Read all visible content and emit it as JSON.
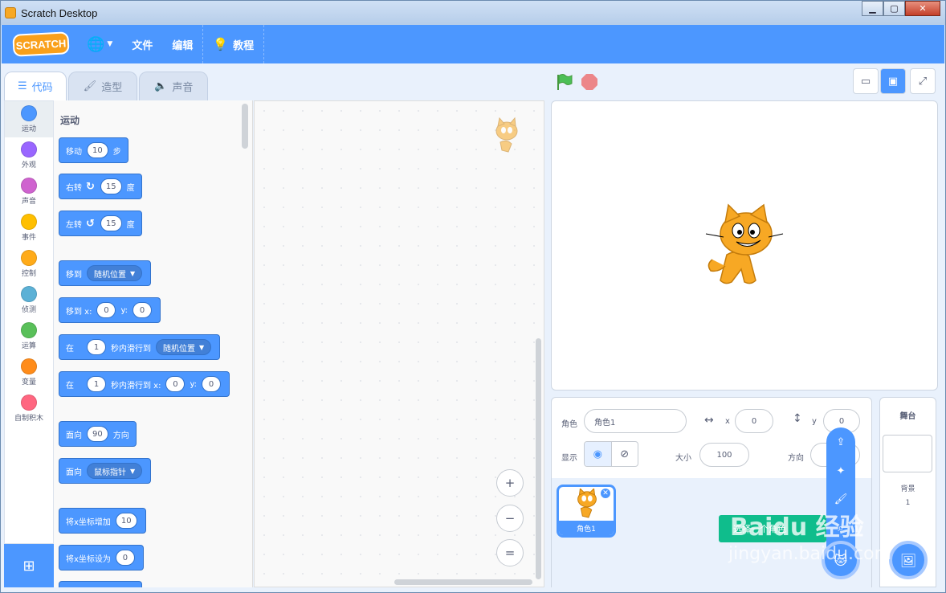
{
  "window": {
    "title": "Scratch Desktop",
    "buttons": [
      "▁",
      "▢",
      "✕"
    ]
  },
  "menubar": {
    "logo": "SCRATCH",
    "file": "文件",
    "edit": "编辑",
    "tutorials": "教程"
  },
  "tabs": [
    {
      "label": "代码",
      "icon": "code-icon"
    },
    {
      "label": "造型",
      "icon": "brush-icon"
    },
    {
      "label": "声音",
      "icon": "speaker-icon"
    }
  ],
  "categories": [
    {
      "label": "运动",
      "color": "#4c97ff"
    },
    {
      "label": "外观",
      "color": "#9966ff"
    },
    {
      "label": "声音",
      "color": "#cf63cf"
    },
    {
      "label": "事件",
      "color": "#ffbf00"
    },
    {
      "label": "控制",
      "color": "#ffab19"
    },
    {
      "label": "侦测",
      "color": "#5cb1d6"
    },
    {
      "label": "运算",
      "color": "#59c059"
    },
    {
      "label": "变量",
      "color": "#ff8c1a"
    },
    {
      "label": "自制积木",
      "color": "#ff6680"
    }
  ],
  "flyout": {
    "title": "运动",
    "move": {
      "a": "移动",
      "n": "10",
      "b": "步"
    },
    "turn_right": {
      "a": "右转",
      "n": "15",
      "b": "度"
    },
    "turn_left": {
      "a": "左转",
      "n": "15",
      "b": "度"
    },
    "goto": {
      "a": "移到",
      "opt": "随机位置"
    },
    "goto_xy": {
      "a": "移到 x:",
      "x": "0",
      "y_label": "y:",
      "y": "0"
    },
    "glide": {
      "a": "在",
      "n": "1",
      "b": "秒内滑行到",
      "opt": "随机位置"
    },
    "glide_xy": {
      "a": "在",
      "n": "1",
      "b": "秒内滑行到 x:",
      "x": "0",
      "y_label": "y:",
      "y": "0"
    },
    "point": {
      "a": "面向",
      "n": "90",
      "b": "方向"
    },
    "point_towards": {
      "a": "面向",
      "opt": "鼠标指针"
    },
    "change_x": {
      "a": "将x坐标增加",
      "n": "10"
    },
    "set_x": {
      "a": "将x坐标设为",
      "n": "0"
    }
  },
  "zoom": {
    "in": "+",
    "out": "−",
    "reset": "="
  },
  "sprite_info": {
    "sprite_label": "角色",
    "sprite_name": "角色1",
    "x_label": "x",
    "x": "0",
    "y_label": "y",
    "y": "0",
    "show_label": "显示",
    "size_label": "大小",
    "size": "100",
    "direction_label": "方向"
  },
  "sprites": [
    {
      "name": "角色1"
    }
  ],
  "add_sprite_tooltip": "选择一个角色",
  "stage_pane": {
    "title": "舞台",
    "backdrops_label": "背景",
    "backdrops_count": "1"
  },
  "watermark": {
    "main": "Baidu 经验",
    "sub": "jingyan.baidu.com"
  }
}
